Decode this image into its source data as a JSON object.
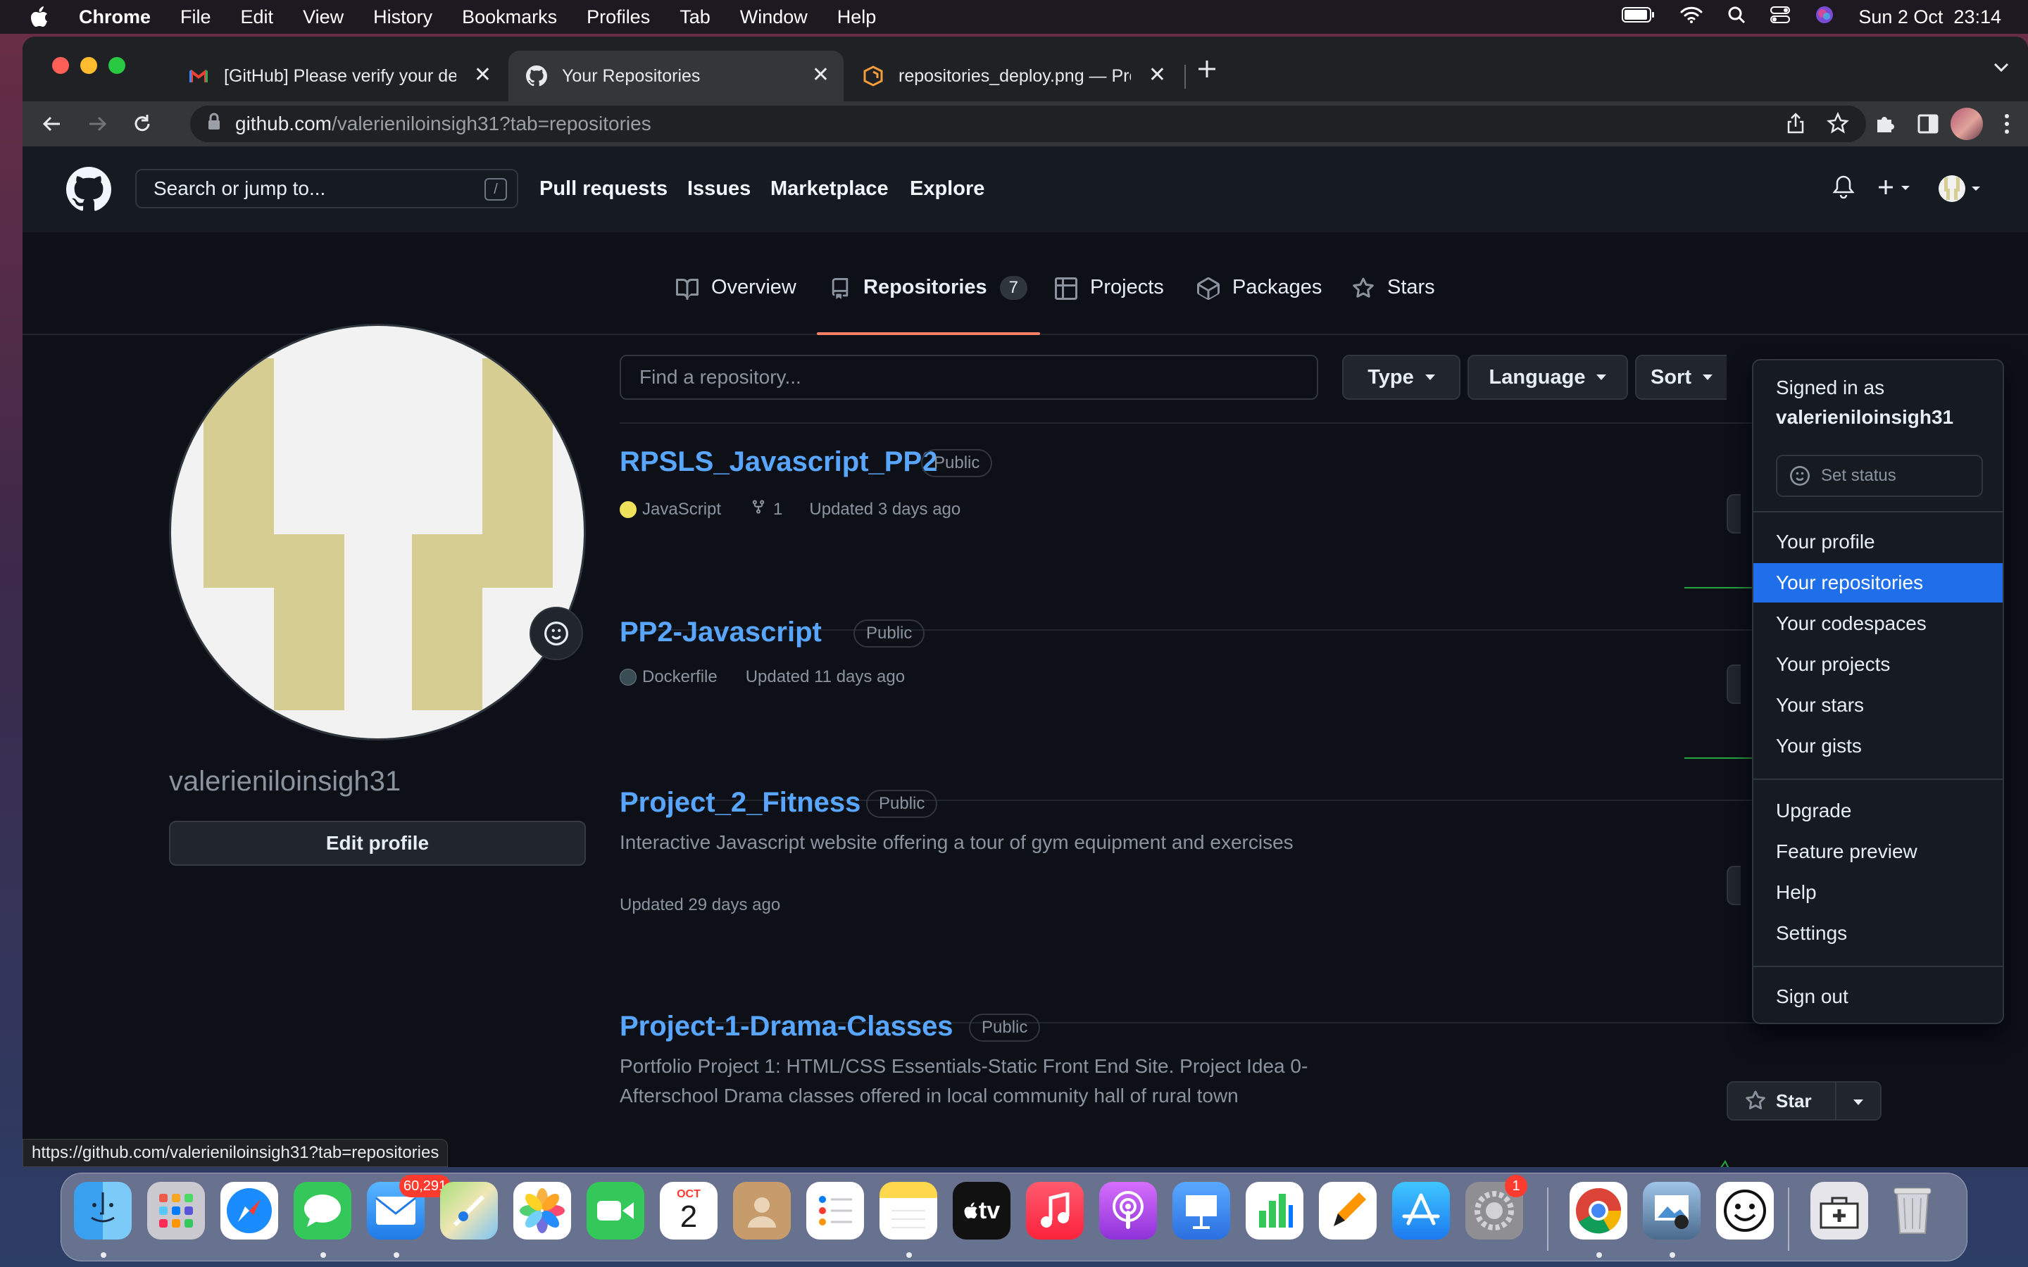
{
  "menubar": {
    "app": "Chrome",
    "items": [
      "File",
      "Edit",
      "View",
      "History",
      "Bookmarks",
      "Profiles",
      "Tab",
      "Window",
      "Help"
    ],
    "clock": "Sun 2 Oct  23:14"
  },
  "browser": {
    "tabs": [
      {
        "title": "[GitHub] Please verify your dev",
        "icon": "gmail-icon"
      },
      {
        "title": "Your Repositories",
        "icon": "github-icon"
      },
      {
        "title": "repositories_deploy.png — Pro",
        "icon": "app-icon"
      }
    ],
    "url_host": "github.com",
    "url_path": "/valerieniloinsigh31?tab=repositories",
    "status_url": "https://github.com/valerieniloinsigh31?tab=repositories"
  },
  "github": {
    "search_placeholder": "Search or jump to...",
    "search_key": "/",
    "nav": [
      "Pull requests",
      "Issues",
      "Marketplace",
      "Explore"
    ],
    "profile_tabs": [
      {
        "label": "Overview",
        "icon": "book-icon"
      },
      {
        "label": "Repositories",
        "icon": "repo-icon",
        "count": "7"
      },
      {
        "label": "Projects",
        "icon": "table-icon"
      },
      {
        "label": "Packages",
        "icon": "package-icon"
      },
      {
        "label": "Stars",
        "icon": "star-icon"
      }
    ],
    "username": "valerieniloinsigh31",
    "edit_profile": "Edit profile",
    "find_placeholder": "Find a repository...",
    "filters": [
      "Type",
      "Language",
      "Sort"
    ],
    "repos": [
      {
        "name": "RPSLS_Javascript_PP2",
        "visibility": "Public",
        "language": "JavaScript",
        "lang_color": "#f1e05a",
        "forks": "1",
        "updated": "Updated 3 days ago"
      },
      {
        "name": "PP2-Javascript",
        "visibility": "Public",
        "language": "Dockerfile",
        "lang_color": "#384d54",
        "updated": "Updated 11 days ago"
      },
      {
        "name": "Project_2_Fitness",
        "visibility": "Public",
        "description": "Interactive Javascript website offering a tour of gym equipment and exercises",
        "updated": "Updated 29 days ago"
      },
      {
        "name": "Project-1-Drama-Classes",
        "visibility": "Public",
        "description": "Portfolio Project 1: HTML/CSS Essentials-Static Front End Site. Project Idea 0-Afterschool Drama classes offered in local community hall of rural town",
        "star_label": "Star"
      }
    ],
    "dropdown": {
      "signed_in_as": "Signed in as",
      "user": "valerieniloinsigh31",
      "set_status": "Set status",
      "group1": [
        "Your profile",
        "Your repositories",
        "Your codespaces",
        "Your projects",
        "Your stars",
        "Your gists"
      ],
      "group2": [
        "Upgrade",
        "Feature preview",
        "Help",
        "Settings"
      ],
      "sign_out": "Sign out",
      "highlighted": "Your repositories"
    }
  },
  "dock": {
    "apps": [
      "finder-icon",
      "launchpad-icon",
      "safari-icon",
      "messages-icon",
      "mail-icon",
      "maps-icon",
      "photos-icon",
      "facetime-icon",
      "calendar-icon",
      "contacts-icon",
      "reminders-icon",
      "notes-icon",
      "apple-tv-icon",
      "music-icon",
      "podcasts-icon",
      "keynote-icon",
      "numbers-icon",
      "pages-icon",
      "app-store-icon",
      "system-preferences-icon",
      "chrome-icon",
      "preview-icon",
      "emoji-app-icon",
      "first-aid-icon",
      "trash-icon"
    ],
    "mail_badge": "60,291",
    "prefs_badge": "1",
    "calendar_month": "OCT",
    "calendar_day": "2",
    "tv_label": "tv"
  }
}
